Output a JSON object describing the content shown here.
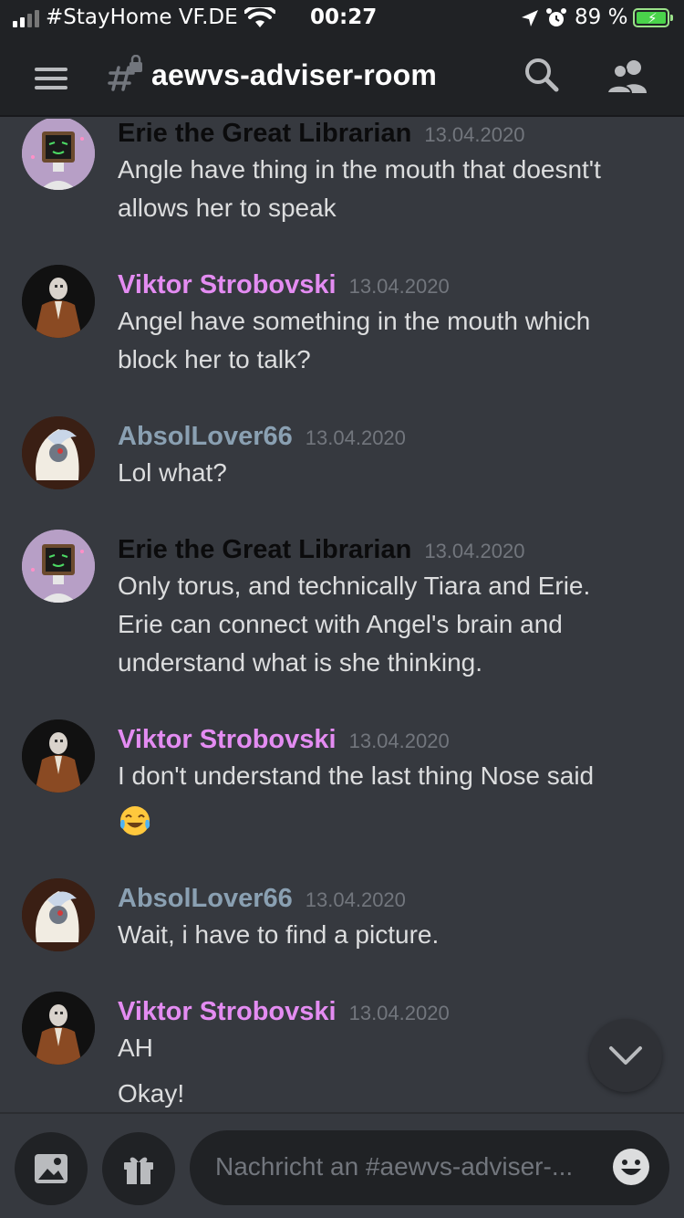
{
  "status_bar": {
    "carrier": "#StayHome VF.DE",
    "time": "00:27",
    "battery_percent": "89 %"
  },
  "header": {
    "channel_name": "aewvs-adviser-room"
  },
  "messages": [
    {
      "author": "Erie the Great Librarian",
      "timestamp": "13.04.2020",
      "author_color": "#0b0b0c",
      "lines": [
        "Angle have thing in the mouth that doesnt't",
        "allows her to speak"
      ]
    },
    {
      "author": "Viktor Strobovski",
      "timestamp": "13.04.2020",
      "author_color": "#e48cf2",
      "lines": [
        "Angel have something in the mouth which",
        "block her to talk?"
      ]
    },
    {
      "author": "AbsolLover66",
      "timestamp": "13.04.2020",
      "author_color": "#8aa0b2",
      "lines": [
        "Lol what?"
      ]
    },
    {
      "author": "Erie the Great Librarian",
      "timestamp": "13.04.2020",
      "author_color": "#0b0b0c",
      "lines": [
        "Only torus, and technically Tiara and Erie.",
        "Erie can connect with Angel's brain and",
        "understand what is she thinking."
      ]
    },
    {
      "author": "Viktor Strobovski",
      "timestamp": "13.04.2020",
      "author_color": "#e48cf2",
      "lines": [
        "I don't understand the last thing Nose said"
      ],
      "emoji": "tears-of-joy-emoji"
    },
    {
      "author": "AbsolLover66",
      "timestamp": "13.04.2020",
      "author_color": "#8aa0b2",
      "lines": [
        "Wait, i have to find a picture."
      ]
    },
    {
      "author": "Viktor Strobovski",
      "timestamp": "13.04.2020",
      "author_color": "#e48cf2",
      "lines": [
        "AH",
        "Okay!"
      ]
    }
  ],
  "composer": {
    "placeholder": "Nachricht an #aewvs-adviser-..."
  },
  "icons": {
    "menu": "menu-icon",
    "channel": "locked-text-channel-icon",
    "search": "search-icon",
    "members": "members-icon",
    "scroll_down": "chevron-down-icon",
    "image": "image-icon",
    "gift": "gift-icon",
    "emoji": "emoji-icon"
  }
}
